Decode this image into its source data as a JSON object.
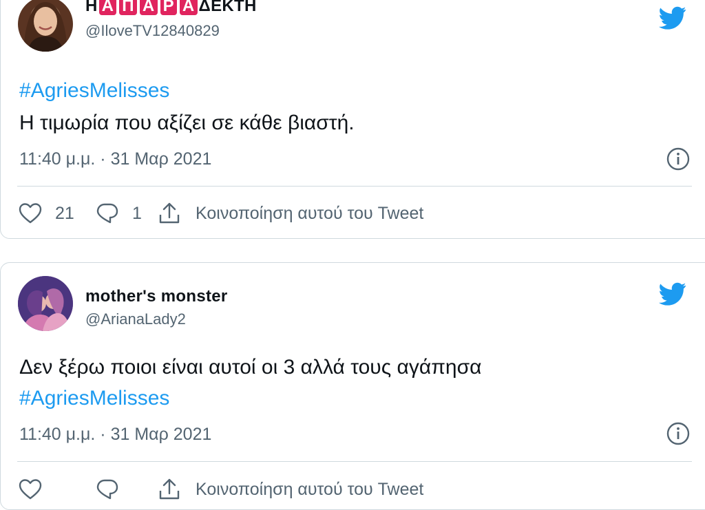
{
  "tweets": [
    {
      "display_name": {
        "prefix": "Η ",
        "boxed_letters": [
          "Α",
          "Π",
          "Α",
          "Ρ",
          "Α"
        ],
        "suffix": "ΔΕΚΤΗ"
      },
      "handle": "@IloveTV12840829",
      "hashtag": "#AgriesMelisses",
      "text": "Η τιμωρία που αξίζει σε κάθε βιαστή.",
      "timestamp": "11:40 μ.μ. · 31 Μαρ 2021",
      "likes": "21",
      "replies": "1",
      "share_label": "Κοινοποίηση αυτού του Tweet"
    },
    {
      "display_name": "mother's monster",
      "handle": "@ArianaLady2",
      "text": "Δεν ξέρω ποιοι είναι αυτοί οι 3 αλλά τους αγάπησα",
      "hashtag": "#AgriesMelisses",
      "timestamp": "11:40 μ.μ. · 31 Μαρ 2021",
      "likes": "",
      "replies": "",
      "share_label": "Κοινοποίηση αυτού του Tweet"
    }
  ],
  "colors": {
    "accent": "#1d9bf0",
    "secondary_text": "#536471",
    "border": "#cfd9de",
    "name_highlight": "#e0245e"
  },
  "icons": [
    "twitter-bird-icon",
    "info-icon",
    "heart-icon",
    "reply-icon",
    "share-icon"
  ]
}
